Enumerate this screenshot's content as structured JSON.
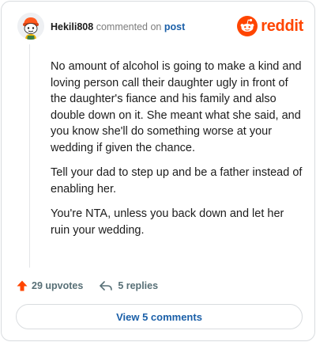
{
  "header": {
    "username": "Hekili808",
    "action_text": "commented on",
    "target_text": "post",
    "brand_name": "reddit"
  },
  "comment": {
    "paragraphs": [
      "No amount of alcohol is going to make a kind and loving person call their daughter ugly in front of the daughter's fiance and his family and also double down on it. She meant what she said, and you know she'll do something worse at your wedding if given the chance.",
      "Tell your dad to step up and be a father instead of enabling her.",
      "You're NTA, unless you back down and let her ruin your wedding."
    ]
  },
  "actions": {
    "upvotes_label": "29 upvotes",
    "replies_label": "5 replies"
  },
  "footer": {
    "view_comments_label": "View 5 comments"
  },
  "colors": {
    "brand_orange": "#ff4500",
    "link_blue": "#1a5fa8",
    "muted_gray": "#576f76"
  },
  "icons": {
    "avatar": "snoo-avatar",
    "brand": "reddit-logo-icon",
    "upvote": "upvote-arrow-icon",
    "reply": "reply-arrow-icon"
  }
}
